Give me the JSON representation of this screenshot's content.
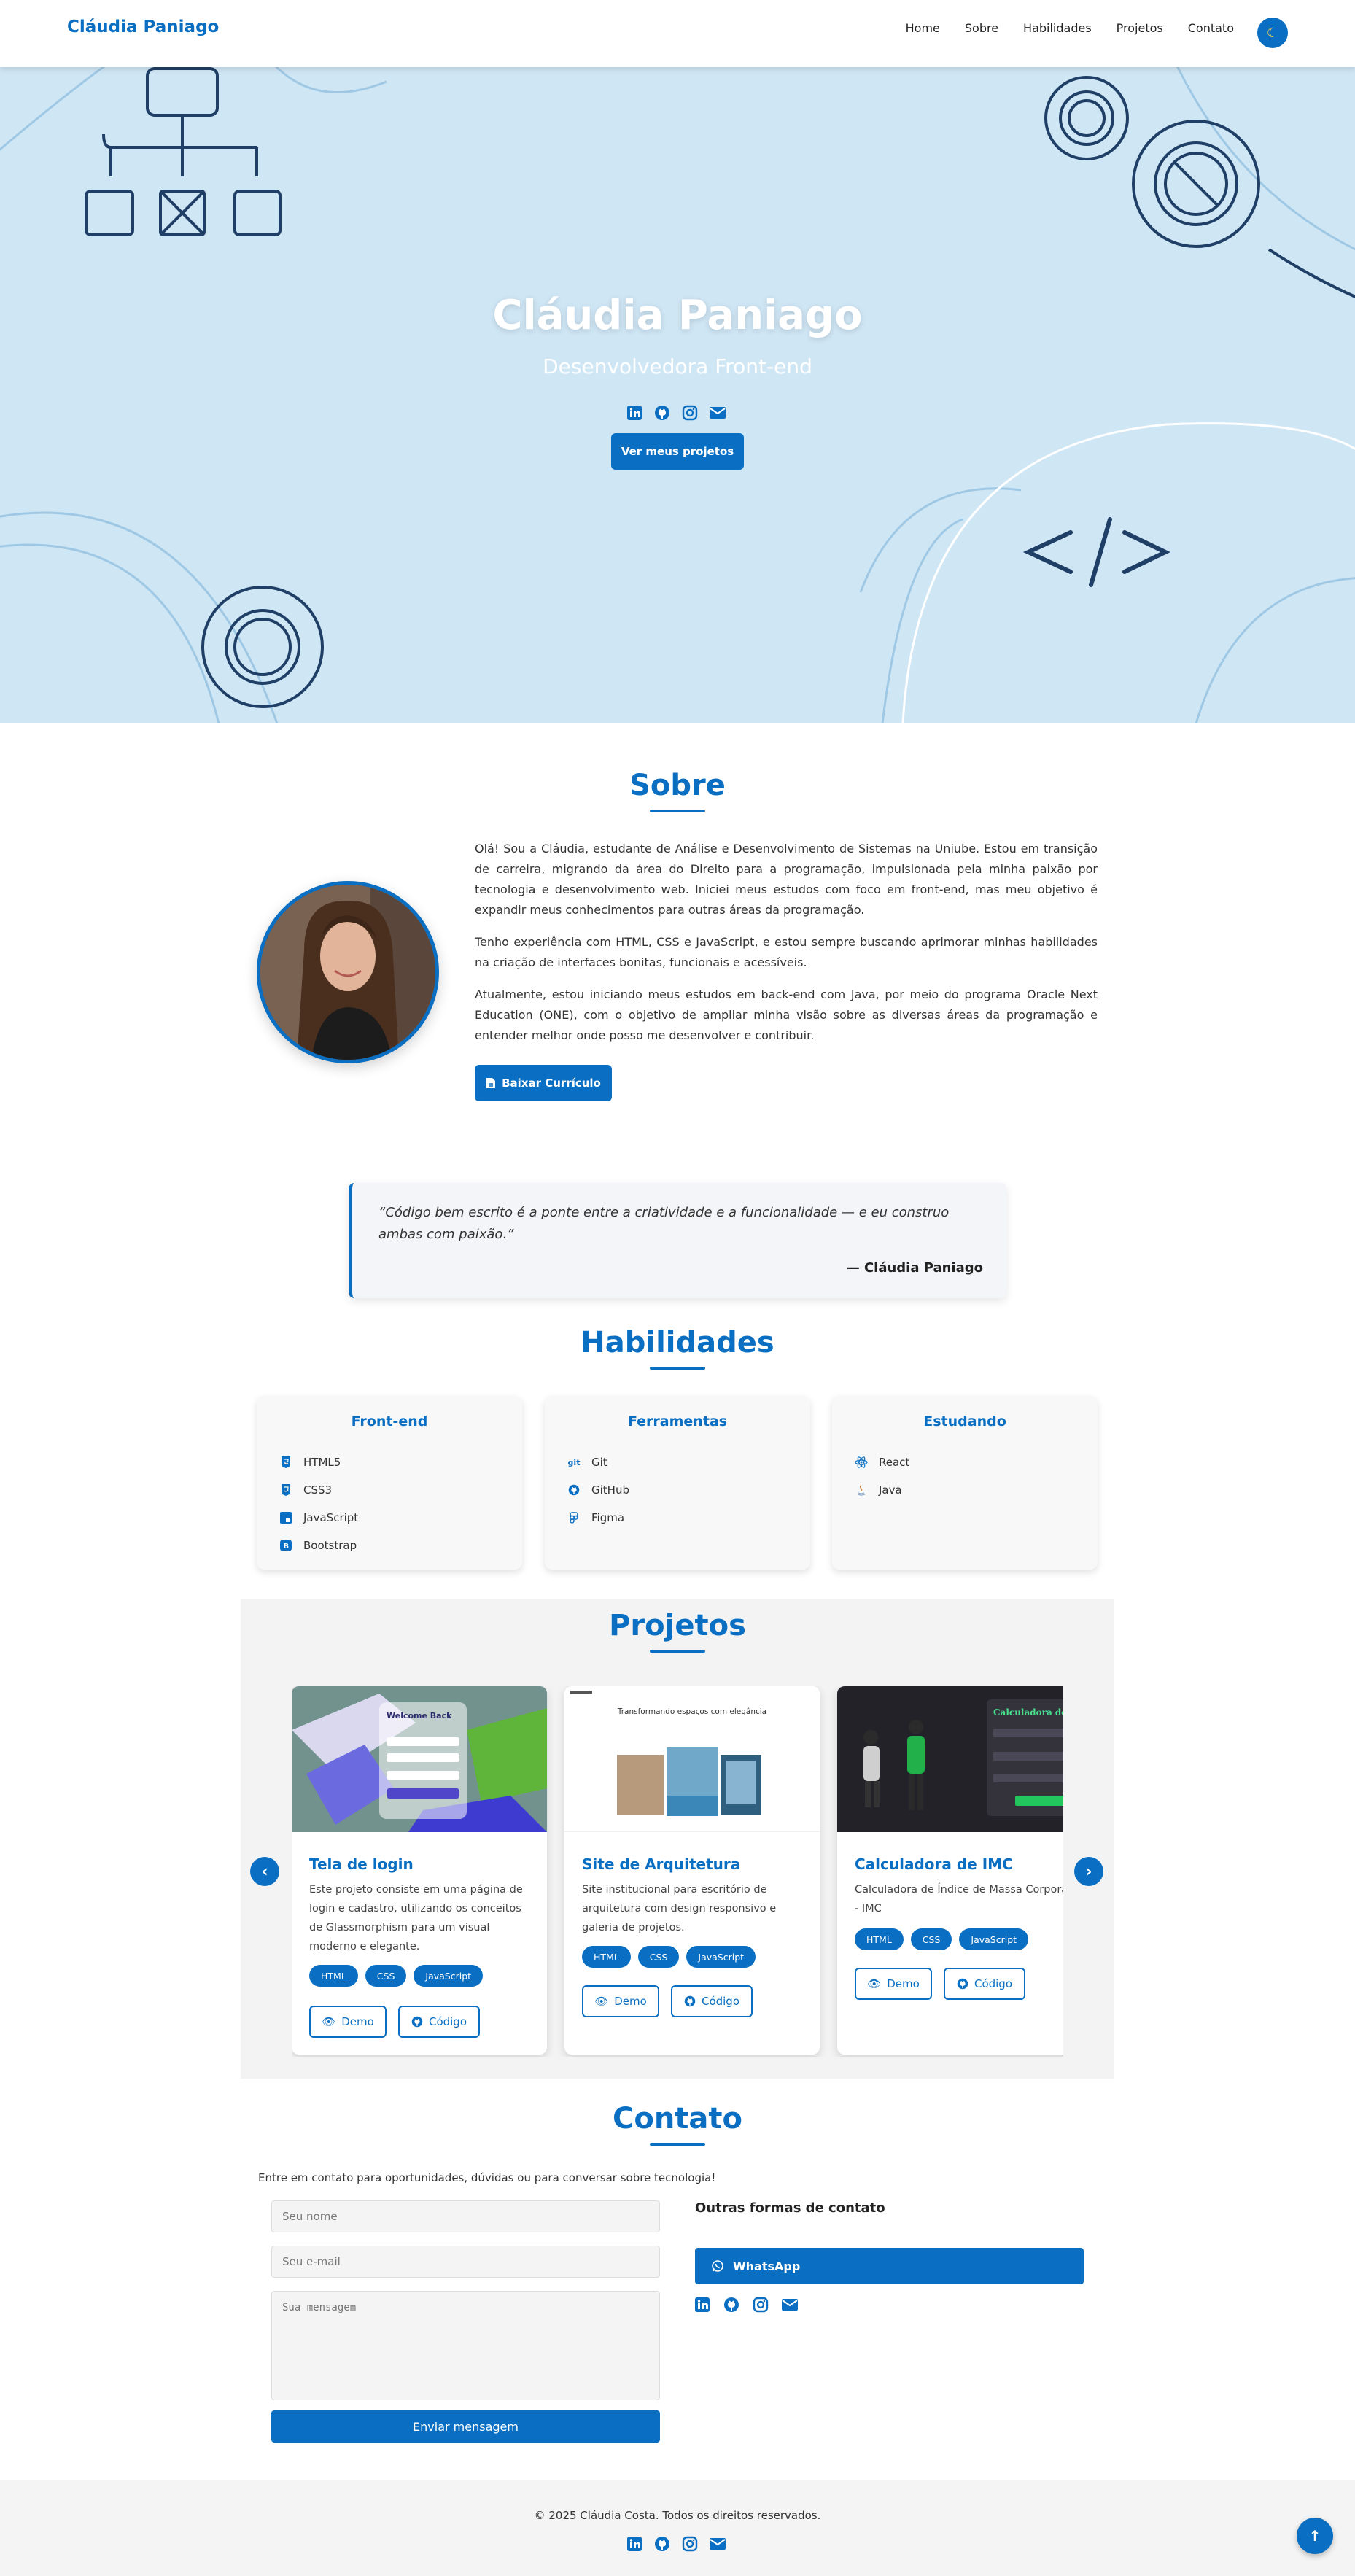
{
  "nav": {
    "brand": "Cláudia Paniago",
    "links": [
      "Home",
      "Sobre",
      "Habilidades",
      "Projetos",
      "Contato"
    ],
    "theme_icon": "moon-icon"
  },
  "hero": {
    "title": "Cláudia Paniago",
    "subtitle": "Desenvolvedora Front-end",
    "social_icons": [
      "linkedin-icon",
      "github-icon",
      "instagram-icon",
      "envelope-icon"
    ],
    "cta_label": "Ver meus projetos"
  },
  "about": {
    "title": "Sobre",
    "paragraphs": [
      "Olá! Sou a Cláudia, estudante de Análise e Desenvolvimento de Sistemas na Uniube. Estou em transição de carreira, migrando da área do Direito para a programação, impulsionada pela minha paixão por tecnologia e desenvolvimento web. Iniciei meus estudos com foco em front-end, mas meu objetivo é expandir meus conhecimentos para outras áreas da programação.",
      "Tenho experiência com HTML, CSS e JavaScript, e estou sempre buscando aprimorar minhas habilidades na criação de interfaces bonitas, funcionais e acessíveis.",
      "Atualmente, estou iniciando meus estudos em back-end com Java, por meio do programa Oracle Next Education (ONE), com o objetivo de ampliar minha visão sobre as diversas áreas da programação e entender melhor onde posso me desenvolver e contribuir."
    ],
    "cv_button": "Baixar Currículo"
  },
  "quote": {
    "text": "“Código bem escrito é a ponte entre a criatividade e a funcionalidade — e eu construo ambas com paixão.”",
    "author": "— Cláudia Paniago"
  },
  "skills": {
    "title": "Habilidades",
    "groups": [
      {
        "title": "Front-end",
        "items": [
          "HTML5",
          "CSS3",
          "JavaScript",
          "Bootstrap"
        ]
      },
      {
        "title": "Ferramentas",
        "items": [
          "Git",
          "GitHub",
          "Figma"
        ]
      },
      {
        "title": "Estudando",
        "items": [
          "React",
          "Java"
        ]
      }
    ]
  },
  "projects": {
    "title": "Projetos",
    "demo_label": "Demo",
    "code_label": "Código",
    "items": [
      {
        "title": "Tela de login",
        "description": "Este projeto consiste em uma página de login e cadastro, utilizando os conceitos de Glassmorphism para um visual moderno e elegante.",
        "tags": [
          "HTML",
          "CSS",
          "JavaScript"
        ],
        "image_text": "Welcome Back"
      },
      {
        "title": "Site de Arquitetura",
        "description": "Site institucional para escritório de arquitetura com design responsivo e galeria de projetos.",
        "tags": [
          "HTML",
          "CSS",
          "JavaScript"
        ],
        "image_text": "Transformando espaços com elegância"
      },
      {
        "title": "Calculadora de IMC",
        "description": "Calculadora de Índice de Massa Corporal - IMC",
        "tags": [
          "HTML",
          "CSS",
          "JavaScript"
        ],
        "image_text": "Calculadora de IMC"
      }
    ]
  },
  "contact": {
    "title": "Contato",
    "intro": "Entre em contato para oportunidades, dúvidas ou para conversar sobre tecnologia!",
    "name_placeholder": "Seu nome",
    "email_placeholder": "Seu e-mail",
    "message_placeholder": "Sua mensagem",
    "send_label": "Enviar mensagem",
    "other_title": "Outras formas de contato",
    "whatsapp_label": "WhatsApp"
  },
  "footer": {
    "text": "© 2025 Cláudia Costa. Todos os direitos reservados."
  },
  "colors": {
    "accent": "#0a6fc2",
    "hero_bg": "#cfe6f5",
    "icon_dark": "#1f3f66"
  }
}
